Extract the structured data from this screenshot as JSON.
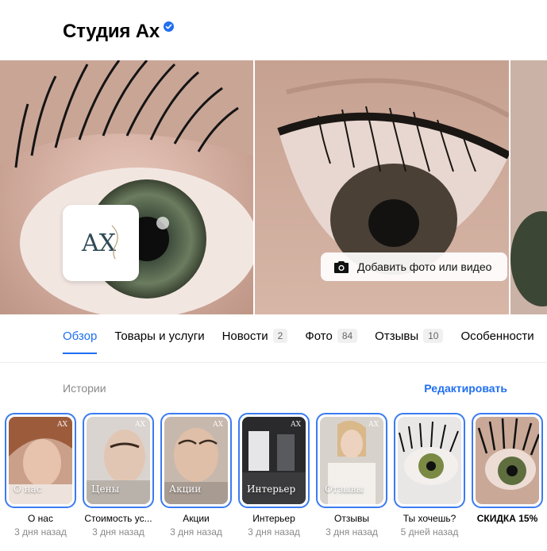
{
  "org": {
    "name": "Студия Ах",
    "verified_icon": "verified-badge-icon"
  },
  "gallery": {
    "add_media_label": "Добавить фото или видео",
    "logo_text": "AX"
  },
  "tabs": [
    {
      "label": "Обзор",
      "count": "",
      "active": true
    },
    {
      "label": "Товары и услуги",
      "count": ""
    },
    {
      "label": "Новости",
      "count": "2"
    },
    {
      "label": "Фото",
      "count": "84"
    },
    {
      "label": "Отзывы",
      "count": "10"
    },
    {
      "label": "Особенности",
      "count": ""
    }
  ],
  "stories_section": {
    "label": "Истории",
    "edit_label": "Редактировать"
  },
  "stories": [
    {
      "overlay": "О нас",
      "title": "О нас",
      "time": "3 дня назад",
      "mark": "AX"
    },
    {
      "overlay": "Цены",
      "title": "Стоимость ус...",
      "time": "3 дня назад",
      "mark": "AX"
    },
    {
      "overlay": "Акции",
      "title": "Акции",
      "time": "3 дня назад",
      "mark": "AX"
    },
    {
      "overlay": "Интерьер",
      "title": "Интерьер",
      "time": "3 дня назад",
      "mark": "AX"
    },
    {
      "overlay": "Отзывы",
      "title": "Отзывы",
      "time": "3 дня назад",
      "mark": "AX"
    },
    {
      "overlay": "",
      "title": "Ты хочешь?",
      "time": "5 дней назад",
      "mark": ""
    },
    {
      "overlay": "",
      "title": "СКИДКА 15%",
      "time": "",
      "mark": ""
    }
  ],
  "colors": {
    "accent": "#1f6ff0",
    "story_ring": "#3a7bf2",
    "muted": "#8a8a8a"
  }
}
